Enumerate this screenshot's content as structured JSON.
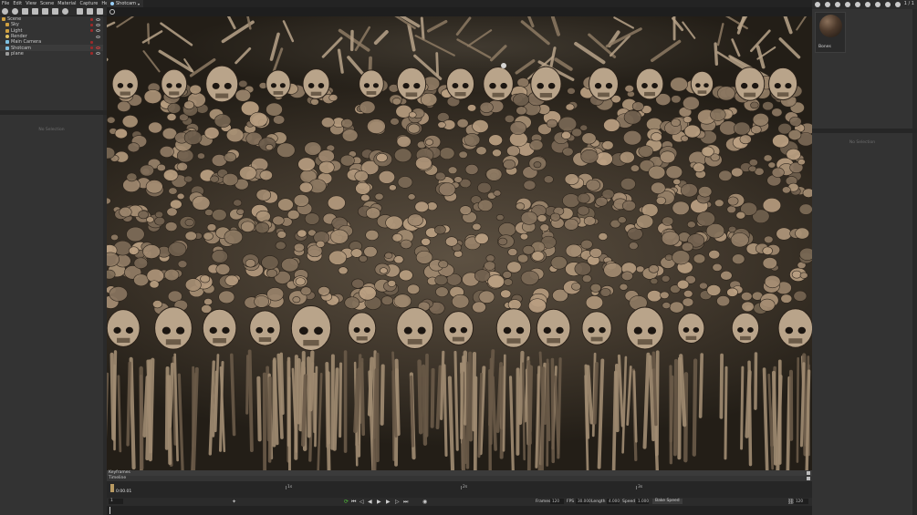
{
  "menu": [
    "File",
    "Edit",
    "View",
    "Scene",
    "Material",
    "Capture",
    "Help"
  ],
  "scene_tree": [
    {
      "label": "Scene",
      "indent": 0,
      "kind": "scene"
    },
    {
      "label": "Sky",
      "indent": 1,
      "kind": "folder"
    },
    {
      "label": "Light",
      "indent": 1,
      "kind": "folder"
    },
    {
      "label": "Render",
      "indent": 1,
      "kind": "render"
    },
    {
      "label": "Main Camera",
      "indent": 1,
      "kind": "camera"
    },
    {
      "label": "Shotcam",
      "indent": 1,
      "kind": "camera"
    },
    {
      "label": "plane",
      "indent": 1,
      "kind": "plane"
    }
  ],
  "left_panel": {
    "no_selection": "No Selection"
  },
  "viewport": {
    "tab_label": "Shotcam"
  },
  "right_panel": {
    "page_indicator": "1 / 1",
    "material_name": "Bones",
    "no_selection": "No Selection"
  },
  "timeline": {
    "keyframes_label": "Keyframes",
    "timeline_label": "Timeline",
    "current_time": "0:00.01",
    "ticks": [
      "1s",
      "2s",
      "3s"
    ],
    "start_frame": "1",
    "frames_label": "Frames",
    "frames_value": "120",
    "fps_label": "FPS",
    "fps_value": "30.000",
    "length_label": "Length",
    "length_value": "4.000",
    "speed_label": "Speed",
    "speed_value": "1.000",
    "bake_label": "Bake Speed",
    "end_frame": "120"
  },
  "colors": {
    "accent_loop": "#4fbf3a",
    "lock_red": "#9c2a2a",
    "bone_light": "#b9a48a",
    "bone_dark": "#6a5a48"
  }
}
